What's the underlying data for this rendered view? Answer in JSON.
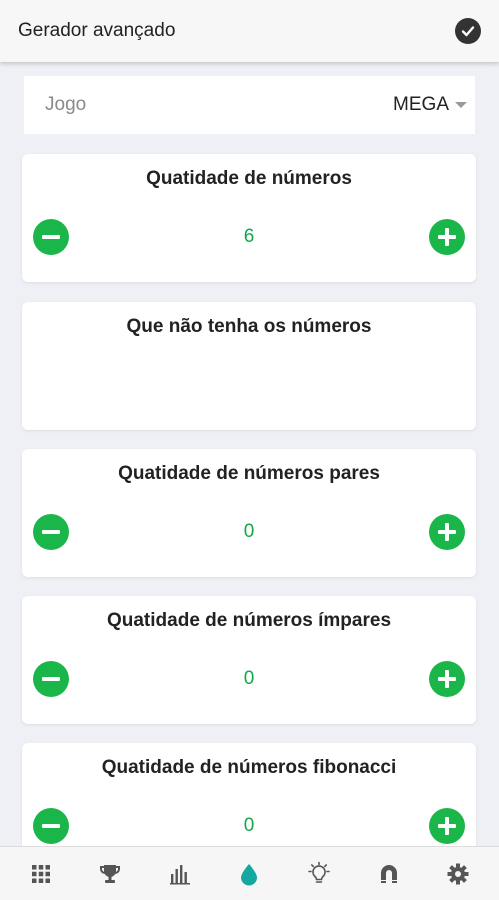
{
  "appbar": {
    "title": "Gerador avançado",
    "confirm_icon": "check-circle-icon"
  },
  "game": {
    "label": "Jogo",
    "value": "MEGA"
  },
  "cards": [
    {
      "title": "Quatidade de números",
      "value": "6"
    },
    {
      "title": "Que não tenha os números"
    },
    {
      "title": "Quatidade de números pares",
      "value": "0"
    },
    {
      "title": "Quatidade de números ímpares",
      "value": "0"
    },
    {
      "title": "Quatidade de números fibonacci",
      "value": "0"
    }
  ],
  "bottom_nav": [
    "grid-icon",
    "trophy-icon",
    "bar-chart-icon",
    "drop-icon",
    "lightbulb-icon",
    "magnet-icon",
    "gear-icon"
  ],
  "colors": {
    "accent": "#1bb64a",
    "value_text": "#12a84a",
    "active_nav": "#14a8a0",
    "nav_icon": "#555555"
  }
}
